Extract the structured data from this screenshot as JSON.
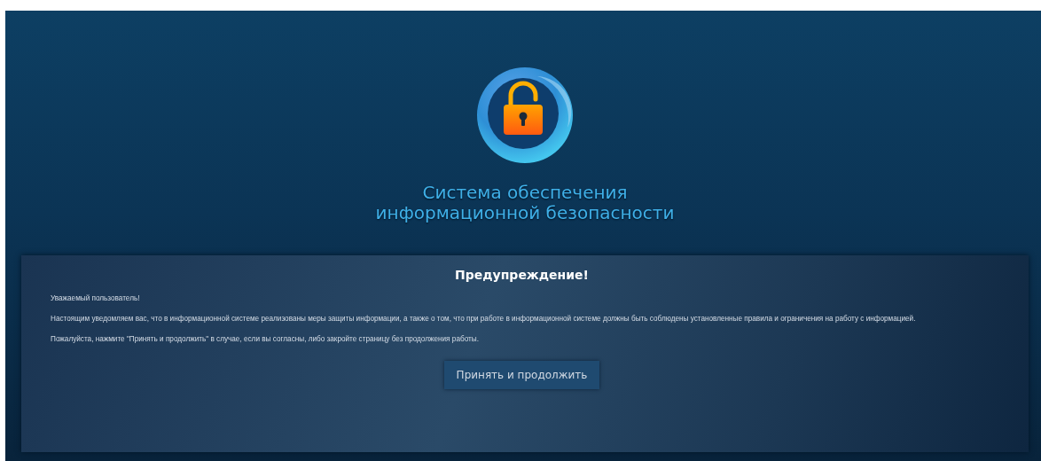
{
  "header": {
    "title_lines": [
      "Система обеспечения",
      "информационной безопасности"
    ]
  },
  "warning": {
    "heading": "Предупреждение!",
    "paragraphs": [
      "Уважаемый пользователь!",
      "Настоящим уведомляем вас, что в информационной системе реализованы меры защиты информации, а также о том, что при работе в информационной системе должны быть соблюдены установленные правила и ограничения на работу с информацией.",
      "Пожалуйста, нажмите \"Принять и продолжить\" в случае, если вы согласны, либо закройте страницу без продолжения работы."
    ],
    "button": "Принять и продолжить"
  }
}
